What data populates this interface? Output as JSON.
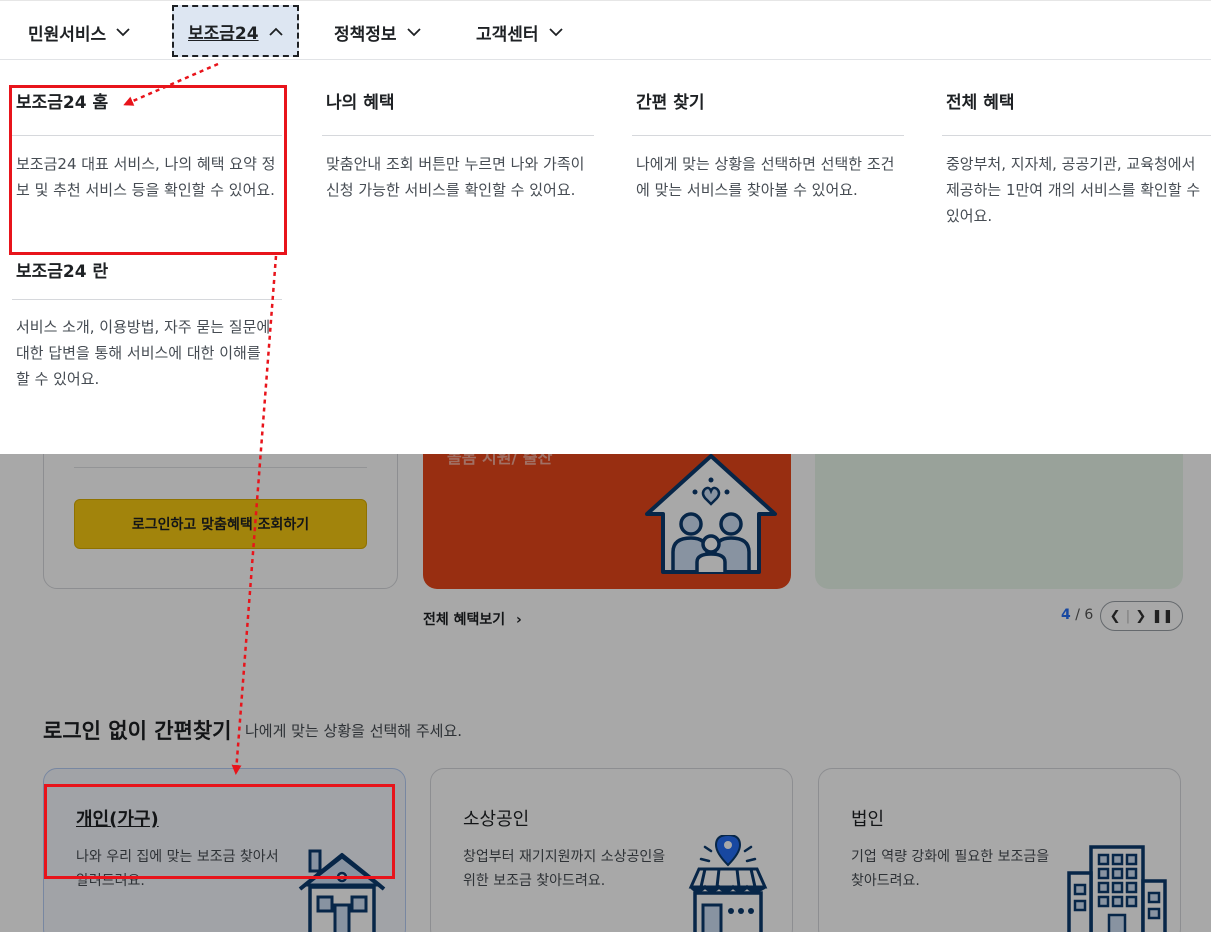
{
  "nav": {
    "items": [
      {
        "label": "민원서비스"
      },
      {
        "label": "보조금24"
      },
      {
        "label": "정책정보"
      },
      {
        "label": "고객센터"
      }
    ]
  },
  "menu": {
    "items": [
      {
        "title": "보조금24 홈",
        "desc": "보조금24 대표 서비스, 나의 혜택 요약 정보 및 추천 서비스 등을 확인할 수 있어요."
      },
      {
        "title": "나의 혜택",
        "desc": "맞춤안내 조회 버튼만 누르면 나와 가족이 신청 가능한 서비스를 확인할 수 있어요."
      },
      {
        "title": "간편 찾기",
        "desc": "나에게 맞는 상황을 선택하면 선택한 조건에 맞는 서비스를 찾아볼 수 있어요."
      },
      {
        "title": "전체 혜택",
        "desc": "중앙부처, 지자체, 공공기관, 교육청에서 제공하는 1만여 개의 서비스를 확인할 수 있어요."
      },
      {
        "title": "보조금24 란",
        "desc": "서비스 소개, 이용방법, 자주 묻는 질문에 대한 답변을 통해 서비스에 대한 이해를 할 수 있어요."
      }
    ]
  },
  "background": {
    "login_button": "로그인하고 맞춤혜택 조회하기",
    "red_card_text": "돌봄 지원/ 출산",
    "all_benefits_link": "전체 혜택보기",
    "pager": {
      "current": "4",
      "total": "6"
    },
    "section_title": "로그인 없이 간편찾기",
    "section_subtitle": "나에게 맞는 상황을 선택해 주세요.",
    "find_cards": [
      {
        "title": "개인(가구)",
        "desc": "나와 우리 집에 맞는 보조금 찾아서 알려드려요."
      },
      {
        "title": "소상공인",
        "desc": "창업부터 재기지원까지 소상공인을 위한 보조금 찾아드려요."
      },
      {
        "title": "법인",
        "desc": "기업 역량 강화에 필요한 보조금을 찾아드려요."
      }
    ]
  },
  "colors": {
    "highlight": "#e8141b",
    "accent_blue": "#256ef4",
    "login_yellow": "#f6c913",
    "card_red": "#e7461b",
    "card_green": "#e8f6ea"
  }
}
